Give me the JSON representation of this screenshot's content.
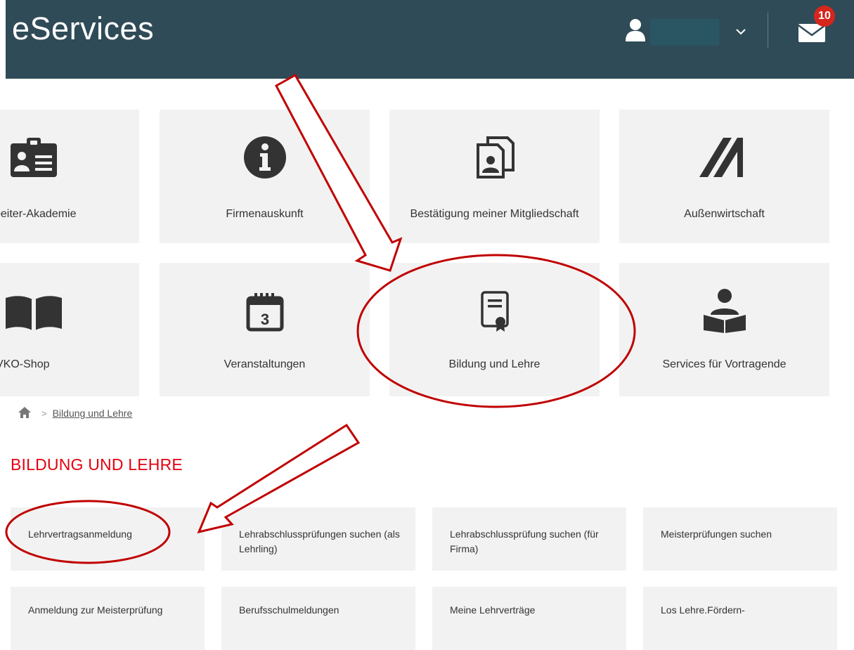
{
  "header": {
    "brand": "eServices",
    "user_icon": "user-icon",
    "mail_badge": "10"
  },
  "tiles_row1": [
    {
      "label": "beiter-Akademie",
      "icon": "id-badge-icon"
    },
    {
      "label": "Firmenauskunft",
      "icon": "info-icon"
    },
    {
      "label": "Bestätigung meiner Mitgliedschaft",
      "icon": "documents-icon"
    },
    {
      "label": "Außenwirtschaft",
      "icon": "aussenwirtschaft-logo-icon"
    }
  ],
  "tiles_row2": [
    {
      "label": "VKO-Shop",
      "icon": "open-book-icon"
    },
    {
      "label": "Veranstaltungen",
      "icon": "calendar-icon"
    },
    {
      "label": "Bildung und Lehre",
      "icon": "certificate-icon"
    },
    {
      "label": "Services für Vortragende",
      "icon": "reader-icon"
    }
  ],
  "breadcrumb": {
    "home_icon": "home-icon",
    "current": "Bildung und Lehre"
  },
  "section": {
    "title": "BILDUNG UND LEHRE",
    "items": [
      {
        "label": "Lehrvertragsanmeldung"
      },
      {
        "label": "Lehrabschlussprüfungen suchen (als Lehrling)"
      },
      {
        "label": "Lehrabschlussprüfung suchen (für Firma)"
      },
      {
        "label": "Meisterprüfungen suchen"
      },
      {
        "label": "Anmeldung zur Meisterprüfung"
      },
      {
        "label": "Berufsschulmeldungen"
      },
      {
        "label": "Meine Lehrverträge"
      },
      {
        "label": "Los Lehre.Fördern-"
      }
    ]
  },
  "annotations": {
    "arrow_color": "#c00000",
    "ellipse_color": "#c00000"
  },
  "calendar_day": "3"
}
